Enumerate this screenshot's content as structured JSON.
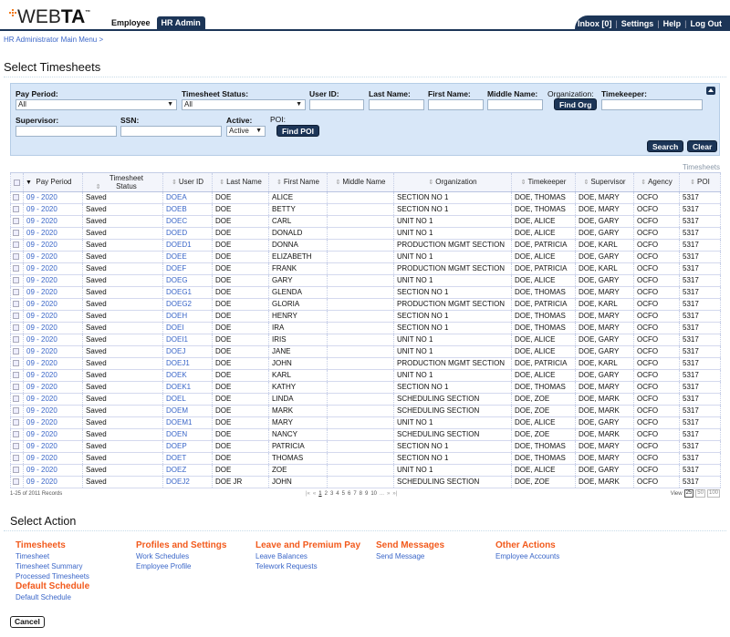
{
  "header": {
    "logo_text_light": "WEB",
    "logo_text_bold": "TA",
    "logo_tm": "™",
    "tabs": [
      {
        "label": "Employee",
        "active": false
      },
      {
        "label": "HR Admin",
        "active": true
      }
    ],
    "utility_links": [
      "Inbox [0]",
      "Settings",
      "Help",
      "Log Out"
    ]
  },
  "breadcrumb": "HR Administrator Main Menu >",
  "page_title": "Select Timesheets",
  "filter": {
    "pay_period_label": "Pay Period:",
    "pay_period_value": "All",
    "timesheet_status_label": "Timesheet Status:",
    "timesheet_status_value": "All",
    "user_id_label": "User ID:",
    "last_name_label": "Last Name:",
    "first_name_label": "First Name:",
    "middle_name_label": "Middle Name:",
    "organization_label": "Organization:",
    "find_org_label": "Find Org",
    "timekeeper_label": "Timekeeper:",
    "supervisor_label": "Supervisor:",
    "ssn_label": "SSN:",
    "active_label": "Active:",
    "active_value": "Active",
    "poi_label": "POI:",
    "find_poi_label": "Find POI",
    "search_label": "Search",
    "clear_label": "Clear"
  },
  "grid": {
    "caption": "Timesheets",
    "columns": [
      "Pay Period",
      "Timesheet Status",
      "User ID",
      "Last Name",
      "First Name",
      "Middle Name",
      "Organization",
      "Timekeeper",
      "Supervisor",
      "Agency",
      "POI"
    ],
    "rows": [
      [
        "09 - 2020",
        "Saved",
        "DOEA",
        "DOE",
        "ALICE",
        "",
        "SECTION NO 1",
        "DOE, THOMAS",
        "DOE, MARY",
        "OCFO",
        "5317"
      ],
      [
        "09 - 2020",
        "Saved",
        "DOEB",
        "DOE",
        "BETTY",
        "",
        "SECTION NO 1",
        "DOE, THOMAS",
        "DOE, MARY",
        "OCFO",
        "5317"
      ],
      [
        "09 - 2020",
        "Saved",
        "DOEC",
        "DOE",
        "CARL",
        "",
        "UNIT NO 1",
        "DOE, ALICE",
        "DOE, GARY",
        "OCFO",
        "5317"
      ],
      [
        "09 - 2020",
        "Saved",
        "DOED",
        "DOE",
        "DONALD",
        "",
        "UNIT NO 1",
        "DOE, ALICE",
        "DOE, GARY",
        "OCFO",
        "5317"
      ],
      [
        "09 - 2020",
        "Saved",
        "DOED1",
        "DOE",
        "DONNA",
        "",
        "PRODUCTION MGMT SECTION",
        "DOE, PATRICIA",
        "DOE, KARL",
        "OCFO",
        "5317"
      ],
      [
        "09 - 2020",
        "Saved",
        "DOEE",
        "DOE",
        "ELIZABETH",
        "",
        "UNIT NO 1",
        "DOE, ALICE",
        "DOE, GARY",
        "OCFO",
        "5317"
      ],
      [
        "09 - 2020",
        "Saved",
        "DOEF",
        "DOE",
        "FRANK",
        "",
        "PRODUCTION MGMT SECTION",
        "DOE, PATRICIA",
        "DOE, KARL",
        "OCFO",
        "5317"
      ],
      [
        "09 - 2020",
        "Saved",
        "DOEG",
        "DOE",
        "GARY",
        "",
        "UNIT NO 1",
        "DOE, ALICE",
        "DOE, GARY",
        "OCFO",
        "5317"
      ],
      [
        "09 - 2020",
        "Saved",
        "DOEG1",
        "DOE",
        "GLENDA",
        "",
        "SECTION NO 1",
        "DOE, THOMAS",
        "DOE, MARY",
        "OCFO",
        "5317"
      ],
      [
        "09 - 2020",
        "Saved",
        "DOEG2",
        "DOE",
        "GLORIA",
        "",
        "PRODUCTION MGMT SECTION",
        "DOE, PATRICIA",
        "DOE, KARL",
        "OCFO",
        "5317"
      ],
      [
        "09 - 2020",
        "Saved",
        "DOEH",
        "DOE",
        "HENRY",
        "",
        "SECTION NO 1",
        "DOE, THOMAS",
        "DOE, MARY",
        "OCFO",
        "5317"
      ],
      [
        "09 - 2020",
        "Saved",
        "DOEI",
        "DOE",
        "IRA",
        "",
        "SECTION NO 1",
        "DOE, THOMAS",
        "DOE, MARY",
        "OCFO",
        "5317"
      ],
      [
        "09 - 2020",
        "Saved",
        "DOEI1",
        "DOE",
        "IRIS",
        "",
        "UNIT NO 1",
        "DOE, ALICE",
        "DOE, GARY",
        "OCFO",
        "5317"
      ],
      [
        "09 - 2020",
        "Saved",
        "DOEJ",
        "DOE",
        "JANE",
        "",
        "UNIT NO 1",
        "DOE, ALICE",
        "DOE, GARY",
        "OCFO",
        "5317"
      ],
      [
        "09 - 2020",
        "Saved",
        "DOEJ1",
        "DOE",
        "JOHN",
        "",
        "PRODUCTION MGMT SECTION",
        "DOE, PATRICIA",
        "DOE, KARL",
        "OCFO",
        "5317"
      ],
      [
        "09 - 2020",
        "Saved",
        "DOEK",
        "DOE",
        "KARL",
        "",
        "UNIT NO 1",
        "DOE, ALICE",
        "DOE, GARY",
        "OCFO",
        "5317"
      ],
      [
        "09 - 2020",
        "Saved",
        "DOEK1",
        "DOE",
        "KATHY",
        "",
        "SECTION NO 1",
        "DOE, THOMAS",
        "DOE, MARY",
        "OCFO",
        "5317"
      ],
      [
        "09 - 2020",
        "Saved",
        "DOEL",
        "DOE",
        "LINDA",
        "",
        "SCHEDULING SECTION",
        "DOE, ZOE",
        "DOE, MARK",
        "OCFO",
        "5317"
      ],
      [
        "09 - 2020",
        "Saved",
        "DOEM",
        "DOE",
        "MARK",
        "",
        "SCHEDULING SECTION",
        "DOE, ZOE",
        "DOE, MARK",
        "OCFO",
        "5317"
      ],
      [
        "09 - 2020",
        "Saved",
        "DOEM1",
        "DOE",
        "MARY",
        "",
        "UNIT NO 1",
        "DOE, ALICE",
        "DOE, GARY",
        "OCFO",
        "5317"
      ],
      [
        "09 - 2020",
        "Saved",
        "DOEN",
        "DOE",
        "NANCY",
        "",
        "SCHEDULING SECTION",
        "DOE, ZOE",
        "DOE, MARK",
        "OCFO",
        "5317"
      ],
      [
        "09 - 2020",
        "Saved",
        "DOEP",
        "DOE",
        "PATRICIA",
        "",
        "SECTION NO 1",
        "DOE, THOMAS",
        "DOE, MARY",
        "OCFO",
        "5317"
      ],
      [
        "09 - 2020",
        "Saved",
        "DOET",
        "DOE",
        "THOMAS",
        "",
        "SECTION NO 1",
        "DOE, THOMAS",
        "DOE, MARY",
        "OCFO",
        "5317"
      ],
      [
        "09 - 2020",
        "Saved",
        "DOEZ",
        "DOE",
        "ZOE",
        "",
        "UNIT NO 1",
        "DOE, ALICE",
        "DOE, GARY",
        "OCFO",
        "5317"
      ],
      [
        "09 - 2020",
        "Saved",
        "DOEJ2",
        "DOE JR",
        "JOHN",
        "",
        "SCHEDULING SECTION",
        "DOE, ZOE",
        "DOE, MARK",
        "OCFO",
        "5317"
      ]
    ],
    "records_text": "1-25 of 2011 Records",
    "pager": {
      "first": "|«",
      "prev": "«",
      "pages": [
        "1",
        "2",
        "3",
        "4",
        "5",
        "6",
        "7",
        "8",
        "9",
        "10"
      ],
      "current": "1",
      "ellipsis": "...",
      "next": "»",
      "last": "»|"
    },
    "view_label": "View",
    "view_options": [
      "25",
      "50",
      "100"
    ],
    "view_selected": "25"
  },
  "actions": {
    "title": "Select Action",
    "groups": [
      {
        "heading": "Timesheets",
        "links": [
          "Timesheet",
          "Timesheet Summary",
          "Processed Timesheets"
        ]
      },
      {
        "heading": "Default Schedule",
        "links": [
          "Default Schedule"
        ]
      },
      {
        "heading": "Profiles and Settings",
        "links": [
          "Work Schedules",
          "Employee Profile"
        ]
      },
      {
        "heading": "Leave and Premium Pay",
        "links": [
          "Leave Balances",
          "Telework Requests"
        ]
      },
      {
        "heading": "Send Messages",
        "links": [
          "Send Message"
        ]
      },
      {
        "heading": "Other Actions",
        "links": [
          "Employee Accounts"
        ]
      }
    ],
    "cancel_label": "Cancel"
  },
  "colors": {
    "navy": "#1c3557",
    "link_blue": "#3a66c8",
    "heading_orange": "#f25a1c",
    "logo_orange": "#f27a1a",
    "filter_bg": "#dbe9fa"
  }
}
